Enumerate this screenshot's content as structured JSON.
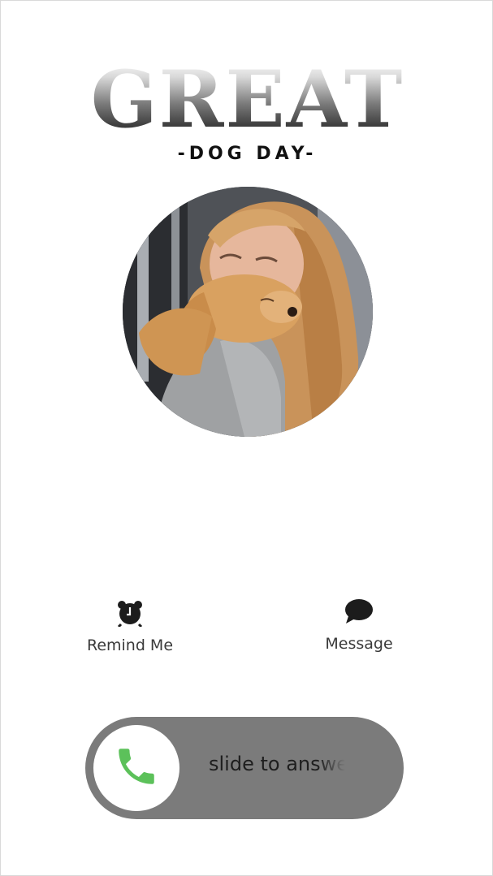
{
  "header": {
    "title": "GREAT",
    "subtitle": "-DOG DAY-"
  },
  "caller": {
    "avatar_icon": "caller-photo"
  },
  "actions": {
    "remind": {
      "label": "Remind Me",
      "icon": "alarm-clock-icon"
    },
    "message": {
      "label": "Message",
      "icon": "speech-bubble-icon"
    }
  },
  "slider": {
    "label": "slide to answer",
    "icon": "phone-icon",
    "colors": {
      "track": "#7b7b7b",
      "knob": "#ffffff",
      "phone": "#5cc15a"
    }
  }
}
